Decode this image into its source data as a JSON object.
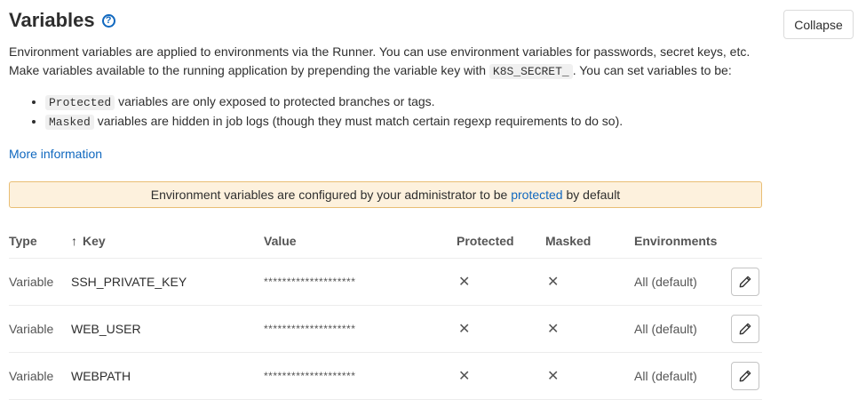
{
  "header": {
    "title": "Variables",
    "help_icon": "question-circle-icon",
    "collapse_label": "Collapse"
  },
  "description": {
    "line1": "Environment variables are applied to environments via the Runner. You can use environment variables for passwords, secret keys, etc.",
    "line2_before": "Make variables available to the running application by prepending the variable key with",
    "line2_code": "K8S_SECRET_",
    "line2_after": ". You can set variables to be:",
    "bullets": [
      {
        "code": "Protected",
        "text": "variables are only exposed to protected branches or tags."
      },
      {
        "code": "Masked",
        "text": "variables are hidden in job logs (though they must match certain regexp requirements to do so)."
      }
    ]
  },
  "more_info_label": "More information",
  "alert": {
    "before": "Environment variables are configured by your administrator to be",
    "link": "protected",
    "after": "by default"
  },
  "table": {
    "headers": {
      "type": "Type",
      "key": "Key",
      "value": "Value",
      "protected": "Protected",
      "masked": "Masked",
      "environments": "Environments"
    },
    "sort_icon": "arrow-up-icon",
    "rows": [
      {
        "type": "Variable",
        "key": "SSH_PRIVATE_KEY",
        "value": "********************",
        "protected": "✕",
        "masked": "✕",
        "environment": "All (default)"
      },
      {
        "type": "Variable",
        "key": "WEB_USER",
        "value": "********************",
        "protected": "✕",
        "masked": "✕",
        "environment": "All (default)"
      },
      {
        "type": "Variable",
        "key": "WEBPATH",
        "value": "********************",
        "protected": "✕",
        "masked": "✕",
        "environment": "All (default)"
      }
    ]
  },
  "colors": {
    "link": "#1068bf",
    "alert_bg": "#fdf1dd",
    "alert_border": "#e9be74"
  }
}
